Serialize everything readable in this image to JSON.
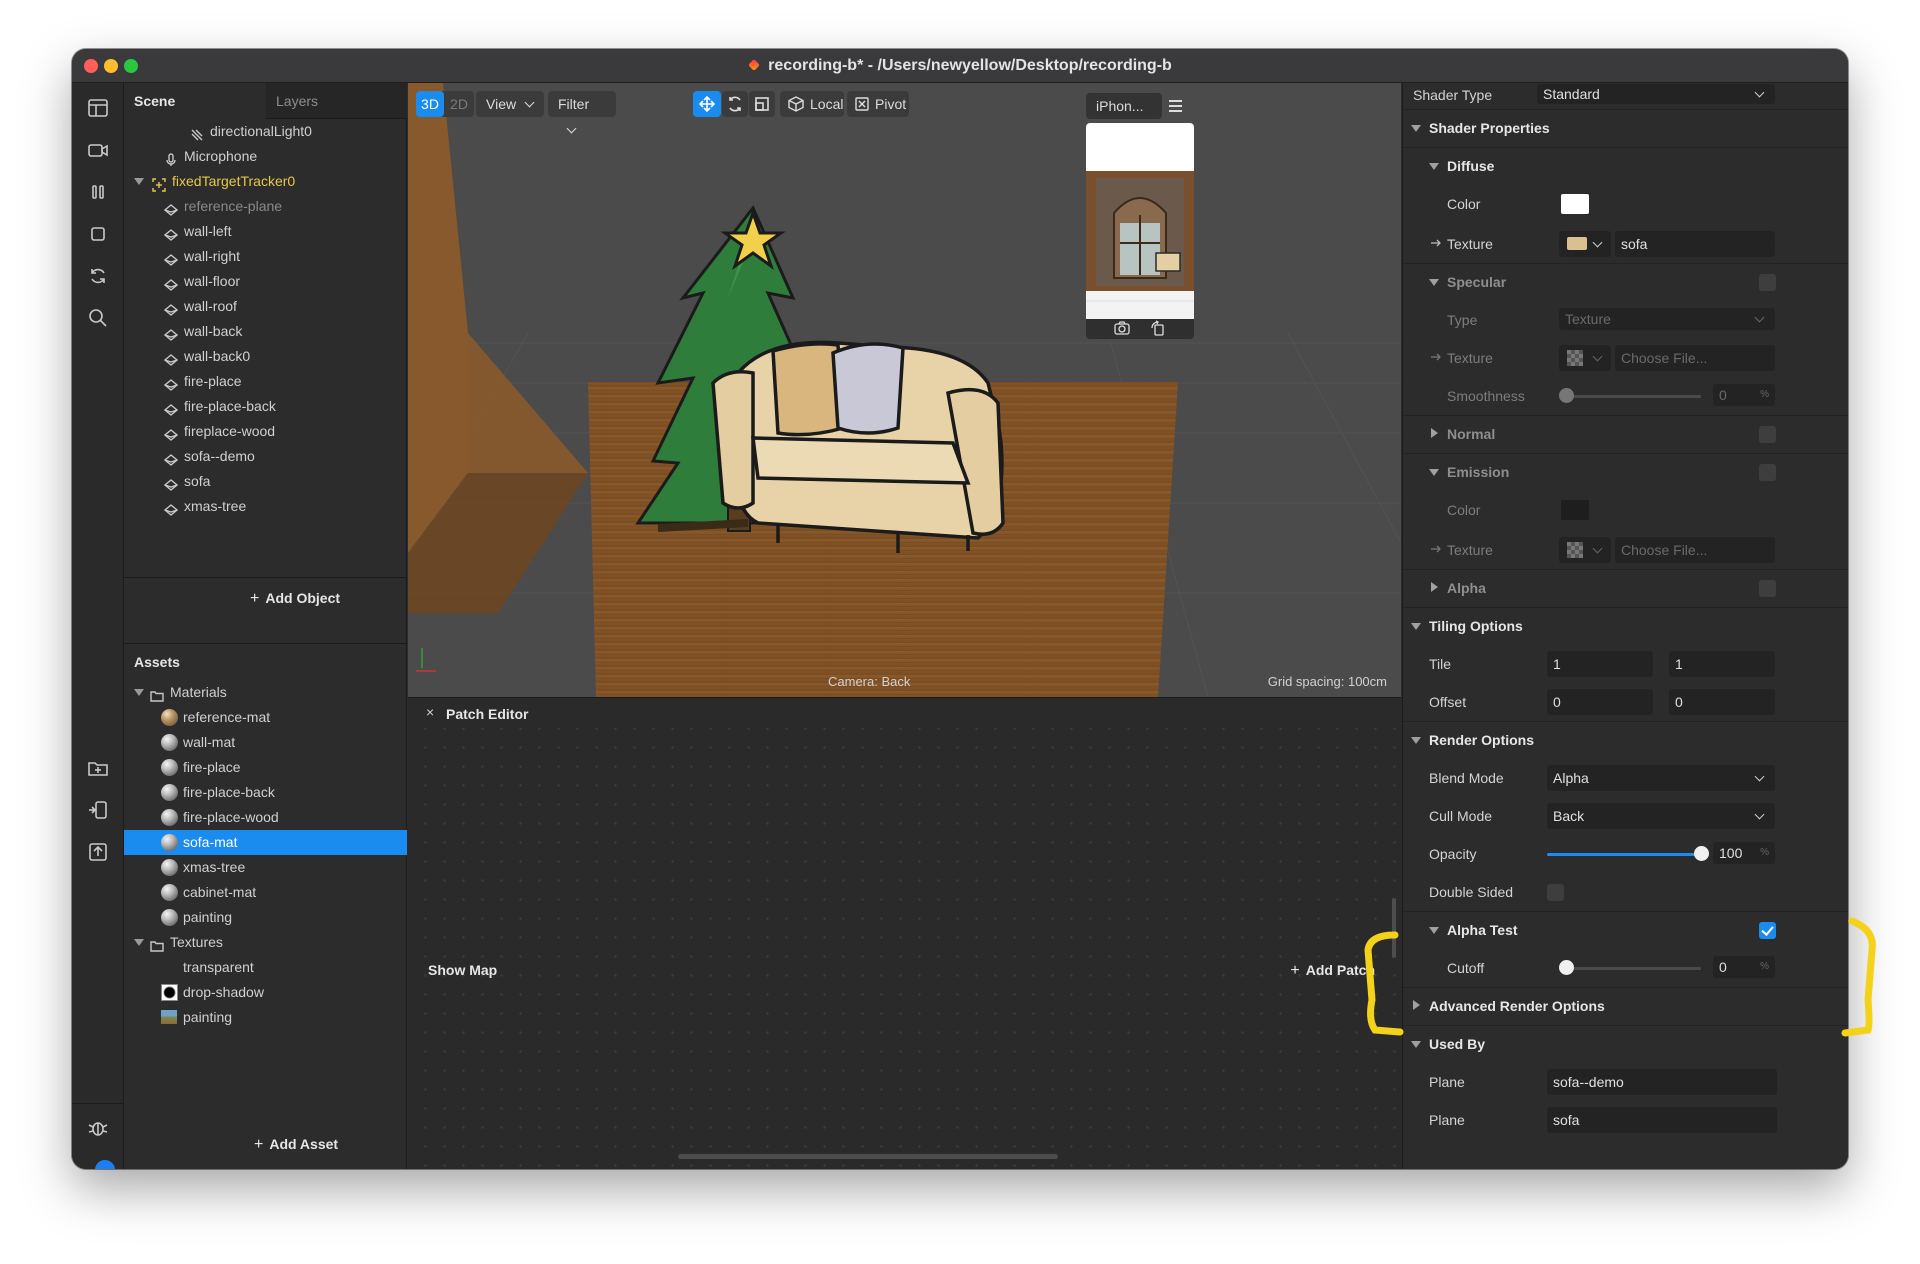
{
  "window": {
    "title": "recording-b* - /Users/newyellow/Desktop/recording-b"
  },
  "colors": {
    "accent": "#1a8cf0",
    "selection": "#1a8cf0",
    "annotation": "#f5d21a"
  },
  "toolbar": {
    "icons": [
      "layout-icon",
      "video-camera-icon",
      "pause-icon",
      "square-icon",
      "refresh-icon",
      "search-icon",
      "add-folder-icon",
      "device-mirror-icon",
      "upload-icon",
      "bug-icon"
    ]
  },
  "scene": {
    "tabs": {
      "scene": "Scene",
      "layers": "Layers"
    },
    "items": [
      {
        "label": "directionalLight0",
        "icon": "light-icon",
        "indent": 2
      },
      {
        "label": "Microphone",
        "icon": "microphone-icon",
        "indent": 1
      },
      {
        "label": "fixedTargetTracker0",
        "icon": "tracker-icon",
        "indent": 0,
        "expanded": true,
        "highlight": true
      },
      {
        "label": "reference-plane",
        "icon": "plane-icon",
        "indent": 1,
        "dim": true
      },
      {
        "label": "wall-left",
        "icon": "plane-icon",
        "indent": 1
      },
      {
        "label": "wall-right",
        "icon": "plane-icon",
        "indent": 1
      },
      {
        "label": "wall-floor",
        "icon": "plane-icon",
        "indent": 1
      },
      {
        "label": "wall-roof",
        "icon": "plane-icon",
        "indent": 1
      },
      {
        "label": "wall-back",
        "icon": "plane-icon",
        "indent": 1
      },
      {
        "label": "wall-back0",
        "icon": "plane-icon",
        "indent": 1
      },
      {
        "label": "fire-place",
        "icon": "plane-icon",
        "indent": 1
      },
      {
        "label": "fire-place-back",
        "icon": "plane-icon",
        "indent": 1
      },
      {
        "label": "fireplace-wood",
        "icon": "plane-icon",
        "indent": 1
      },
      {
        "label": "sofa--demo",
        "icon": "plane-icon",
        "indent": 1
      },
      {
        "label": "sofa",
        "icon": "plane-icon",
        "indent": 1
      },
      {
        "label": "xmas-tree",
        "icon": "plane-icon",
        "indent": 1
      }
    ],
    "add_object": "Add Object"
  },
  "assets": {
    "title": "Assets",
    "materials_label": "Materials",
    "materials": [
      {
        "label": "reference-mat",
        "thumb": "textured"
      },
      {
        "label": "wall-mat",
        "thumb": "sphere"
      },
      {
        "label": "fire-place",
        "thumb": "sphere"
      },
      {
        "label": "fire-place-back",
        "thumb": "sphere"
      },
      {
        "label": "fire-place-wood",
        "thumb": "sphere"
      },
      {
        "label": "sofa-mat",
        "thumb": "sphere",
        "selected": true
      },
      {
        "label": "xmas-tree",
        "thumb": "sphere"
      },
      {
        "label": "cabinet-mat",
        "thumb": "sphere"
      },
      {
        "label": "painting",
        "thumb": "sphere"
      }
    ],
    "textures_label": "Textures",
    "textures": [
      {
        "label": "transparent",
        "thumb": "none"
      },
      {
        "label": "drop-shadow",
        "thumb": "shadow"
      },
      {
        "label": "painting",
        "thumb": "image"
      }
    ],
    "add_asset": "Add Asset"
  },
  "viewport": {
    "mode_3d": "3D",
    "mode_2d": "2D",
    "view": "View",
    "filter": "Filter",
    "local": "Local",
    "pivot": "Pivot",
    "device": "iPhon...",
    "camera_label": "Camera: Back",
    "grid_label": "Grid spacing: 100cm"
  },
  "patch_editor": {
    "title": "Patch Editor",
    "close": "×",
    "show_map": "Show Map",
    "add_patch": "Add Patch"
  },
  "inspector": {
    "shader_type_label": "Shader Type",
    "shader_type_value": "Standard",
    "shader_properties": "Shader Properties",
    "diffuse": "Diffuse",
    "color": "Color",
    "texture": "Texture",
    "diffuse_texture_value": "sofa",
    "specular": "Specular",
    "type": "Type",
    "specular_type_value": "Texture",
    "choose_file": "Choose File...",
    "smoothness": "Smoothness",
    "smoothness_value": "0",
    "normal": "Normal",
    "emission": "Emission",
    "alpha": "Alpha",
    "tiling_options": "Tiling Options",
    "tile": "Tile",
    "tile_x": "1",
    "tile_y": "1",
    "offset": "Offset",
    "offset_x": "0",
    "offset_y": "0",
    "render_options": "Render Options",
    "blend_mode": "Blend Mode",
    "blend_mode_value": "Alpha",
    "cull_mode": "Cull Mode",
    "cull_mode_value": "Back",
    "opacity": "Opacity",
    "opacity_value": "100",
    "opacity_fraction": 1.0,
    "double_sided": "Double Sided",
    "alpha_test": "Alpha Test",
    "alpha_test_checked": true,
    "cutoff": "Cutoff",
    "cutoff_value": "0",
    "advanced_render_options": "Advanced Render Options",
    "used_by": "Used By",
    "plane": "Plane",
    "used_by_1": "sofa--demo",
    "used_by_2": "sofa",
    "pct": "%"
  }
}
